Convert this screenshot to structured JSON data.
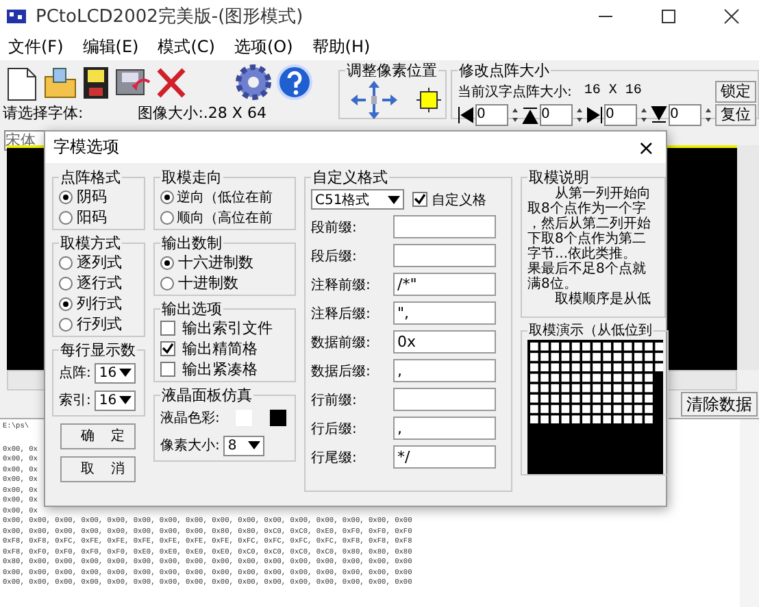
{
  "window": {
    "title": "PCtoLCD2002完美版-(图形模式)"
  },
  "menu": [
    "文件(F)",
    "编辑(E)",
    "模式(C)",
    "选项(O)",
    "帮助(H)"
  ],
  "toolbar": {
    "font_label": "请选择字体:",
    "image_size": "图像大小:.28 X 64"
  },
  "pixel_adjust": {
    "title": "调整像素位置"
  },
  "matrix_size": {
    "title": "修改点阵大小",
    "current_label": "当前汉字点阵大小:",
    "current_value": "16 X 16",
    "lock_button": "锁定",
    "reset_button": "复位",
    "spinners": [
      "0",
      "0",
      "0",
      "0"
    ]
  },
  "font_select": {
    "value": "宋体"
  },
  "clear_button": "清除数据",
  "output": {
    "path": "E:\\ps\\",
    "partial_lines": [
      "0x00, 0x",
      "0x00, 0x",
      "0x00, 0x",
      "0x00, 0x",
      "0x00, 0x",
      "0x00, 0x",
      "0x00, 0x"
    ],
    "lines": [
      "0x00, 0x00, 0x00, 0x00, 0x00, 0x00, 0x00, 0x00, 0x00, 0x00, 0x00, 0x00, 0x00, 0x00, 0x00, 0x00",
      "0x00, 0x00, 0x00, 0x00, 0x00, 0x00, 0x00, 0x00, 0x80, 0x80, 0xC0, 0xC0, 0xE0, 0xF0, 0xF0, 0xF0",
      "0xF8, 0xF8, 0xFC, 0xFE, 0xFE, 0xFE, 0xFE, 0xFE, 0xFE, 0xFC, 0xFC, 0xFC, 0xFC, 0xF8, 0xF8, 0xF8",
      "0xF8, 0xF0, 0xF0, 0xF0, 0xF0, 0xE0, 0xE0, 0xE0, 0xE0, 0xC0, 0xC0, 0xC0, 0xC0, 0x80, 0x80, 0x80",
      "0x80, 0x00, 0x00, 0x00, 0x00, 0x00, 0x00, 0x00, 0x00, 0x00, 0x00, 0x00, 0x00, 0x00, 0x00, 0x00",
      "0x00, 0x00, 0x00, 0x00, 0x00, 0x00, 0x00, 0x00, 0x00, 0x00, 0x00, 0x00, 0x00, 0x00, 0x00, 0x00",
      "0x00, 0x00, 0x00, 0x00, 0x00, 0x00, 0x00, 0x00, 0x00, 0x00, 0x00, 0x00, 0x00, 0x00, 0x00, 0x00"
    ]
  },
  "dialog": {
    "title": "字模选项",
    "close": "×",
    "dot_format": {
      "title": "点阵格式",
      "options": [
        {
          "label": "阴码",
          "selected": true
        },
        {
          "label": "阳码",
          "selected": false
        }
      ]
    },
    "scan_mode": {
      "title": "取模方式",
      "options": [
        {
          "label": "逐列式",
          "selected": false
        },
        {
          "label": "逐行式",
          "selected": false
        },
        {
          "label": "列行式",
          "selected": true
        },
        {
          "label": "行列式",
          "selected": false
        }
      ]
    },
    "per_line": {
      "title": "每行显示数",
      "fields": [
        {
          "label": "点阵:",
          "value": "16"
        },
        {
          "label": "索引:",
          "value": "16"
        }
      ]
    },
    "buttons": [
      "确定",
      "取消"
    ],
    "direction": {
      "title": "取模走向",
      "options": [
        {
          "label": "逆向（低位在前",
          "selected": true
        },
        {
          "label": "顺向（高位在前",
          "selected": false
        }
      ]
    },
    "radix": {
      "title": "输出数制",
      "options": [
        {
          "label": "十六进制数",
          "selected": true
        },
        {
          "label": "十进制数",
          "selected": false
        }
      ]
    },
    "output_options": {
      "title": "输出选项",
      "options": [
        {
          "label": "输出索引文件",
          "checked": false
        },
        {
          "label": "输出精简格",
          "checked": true
        },
        {
          "label": "输出紧凑格",
          "checked": false
        }
      ]
    },
    "lcd_sim": {
      "title": "液晶面板仿真",
      "color_label": "液晶色彩:",
      "colors": [
        {
          "color": "#ffffff"
        },
        {
          "color": "#000000"
        }
      ],
      "size_label": "像素大小:",
      "size_value": "8"
    },
    "custom": {
      "title": "自定义格式",
      "preset": "C51格式",
      "enabled": {
        "label": "自定义格",
        "checked": true
      },
      "fields": [
        {
          "label": "段前缀:"
        },
        {
          "label": "段后缀:"
        },
        {
          "label": "注释前缀:",
          "value": "/*\""
        },
        {
          "label": "注释后缀:",
          "value": "\","
        },
        {
          "label": "数据前缀:",
          "value": "0x"
        },
        {
          "label": "数据后缀:",
          "value": ","
        },
        {
          "label": "行前缀:"
        },
        {
          "label": "行后缀:",
          "value": ","
        },
        {
          "label": "行尾缀:",
          "value": "*/"
        }
      ]
    },
    "description": {
      "title": "取模说明",
      "lines": [
        "　　从第一列开始向",
        "取8个点作为一个字",
        "，然后从第二列开始",
        "下取8个点作为第二",
        "字节...依此类推。",
        "果最后不足8个点就",
        "满8位。",
        "　　取模顺序是从低"
      ]
    },
    "demo": {
      "title": "取模演示（从低位到"
    }
  }
}
